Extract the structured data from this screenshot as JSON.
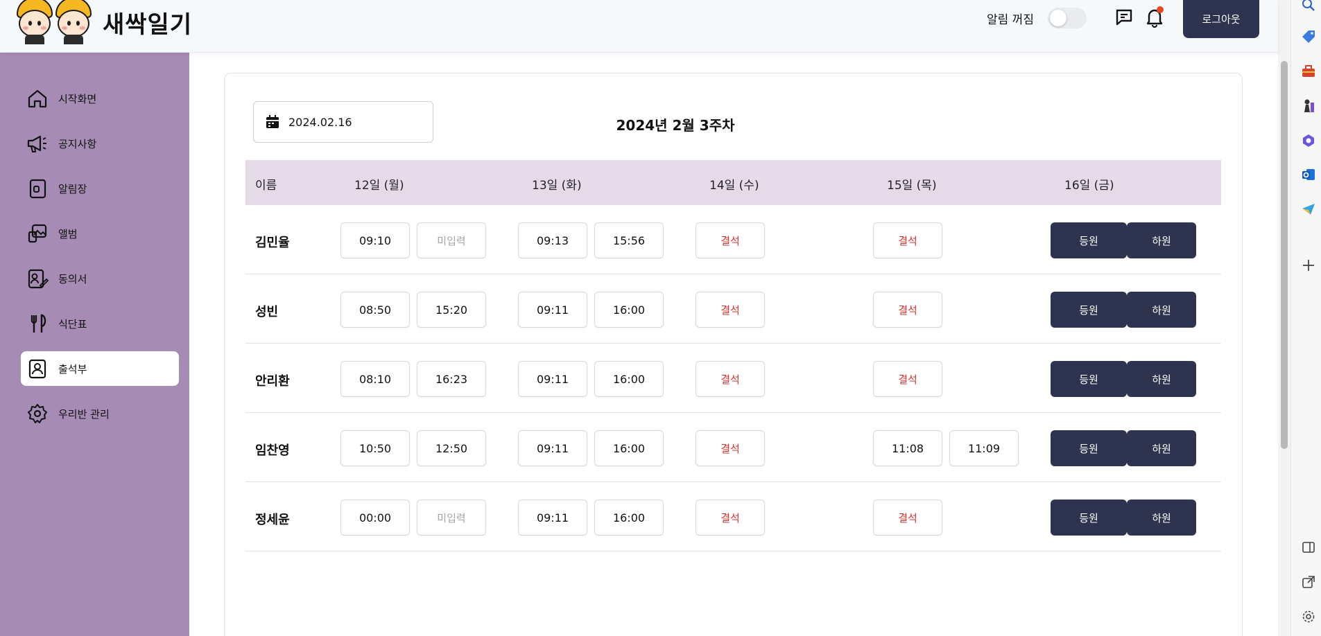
{
  "header": {
    "app_name": "새싹일기",
    "alarm_label": "알림 꺼짐",
    "logout_label": "로그아웃"
  },
  "sidebar": {
    "items": [
      {
        "label": "시작화면",
        "icon": "home-icon"
      },
      {
        "label": "공지사항",
        "icon": "megaphone-icon"
      },
      {
        "label": "알림장",
        "icon": "notebook-icon"
      },
      {
        "label": "앨범",
        "icon": "album-icon"
      },
      {
        "label": "동의서",
        "icon": "consent-icon"
      },
      {
        "label": "식단표",
        "icon": "utensils-icon"
      },
      {
        "label": "출석부",
        "icon": "contacts-icon"
      },
      {
        "label": "우리반 관리",
        "icon": "gear-icon"
      }
    ],
    "active": "출석부"
  },
  "attendance": {
    "date": "2024.02.16",
    "week_title": "2024년 2월 3주차",
    "headers": [
      "이름",
      "12일 (월)",
      "13일 (화)",
      "14일 (수)",
      "15일 (목)",
      "16일 (금)"
    ],
    "rows": [
      {
        "name": "김민율",
        "mon": [
          "09:10",
          "미입력"
        ],
        "tue": [
          "09:13",
          "15:56"
        ],
        "wed": "결석",
        "thu": "결석"
      },
      {
        "name": "성빈",
        "mon": [
          "08:50",
          "15:20"
        ],
        "tue": [
          "09:11",
          "16:00"
        ],
        "wed": "결석",
        "thu": "결석"
      },
      {
        "name": "안리환",
        "mon": [
          "08:10",
          "16:23"
        ],
        "tue": [
          "09:11",
          "16:00"
        ],
        "wed": "결석",
        "thu": "결석"
      },
      {
        "name": "임찬영",
        "mon": [
          "10:50",
          "12:50"
        ],
        "tue": [
          "09:11",
          "16:00"
        ],
        "wed": "결석",
        "thu_times": [
          "11:08",
          "11:09"
        ]
      },
      {
        "name": "정세윤",
        "mon": [
          "00:00",
          "미입력"
        ],
        "tue": [
          "09:11",
          "16:00"
        ],
        "wed": "결석",
        "thu": "결석"
      }
    ],
    "checkin_label": "등원",
    "checkout_label": "하원"
  },
  "colors": {
    "sidebar_bg": "#a68bb5",
    "table_header_bg": "#e5dbe8",
    "button_dark": "#2e3350",
    "absent_red": "#d8312a"
  }
}
